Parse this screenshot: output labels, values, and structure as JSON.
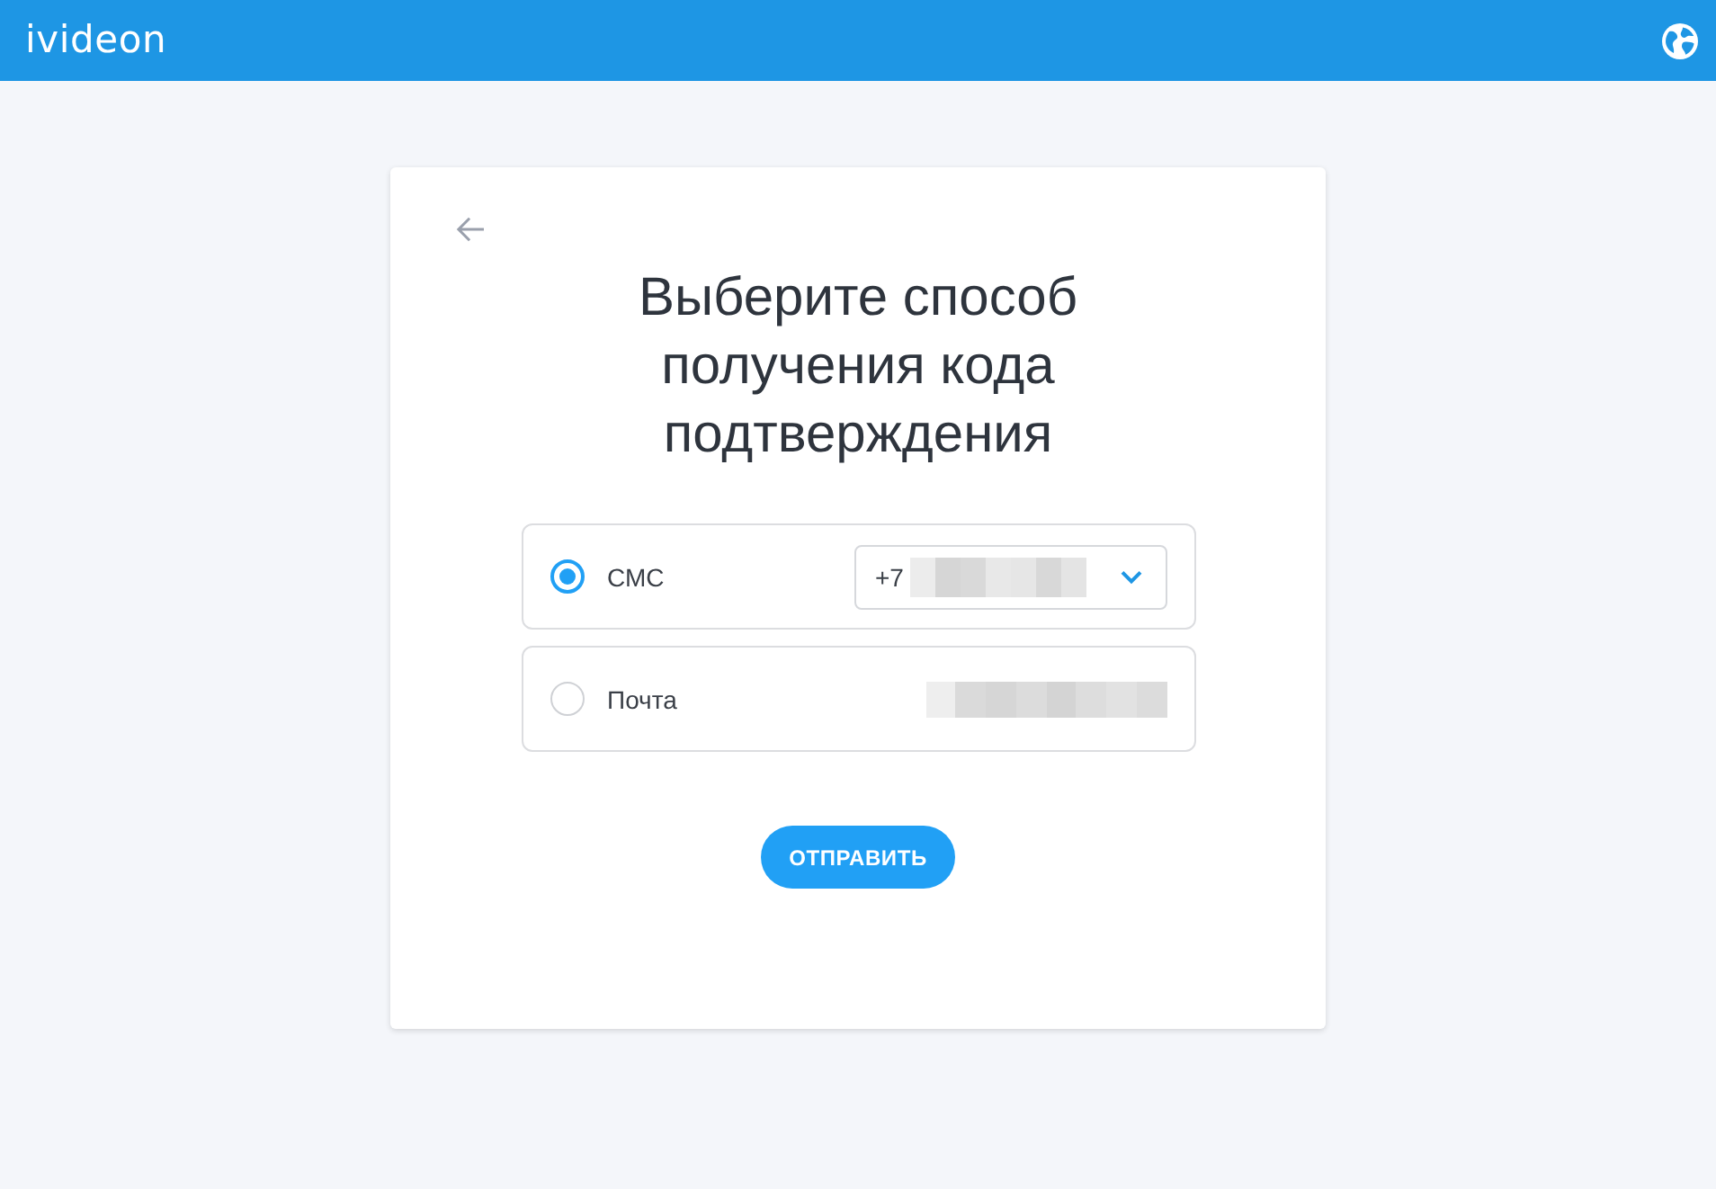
{
  "header": {
    "logo": "ivideon"
  },
  "card": {
    "title": "Выберите способ получения кода подтверждения",
    "options": [
      {
        "kind": "phone",
        "label": "СМС",
        "selected": true,
        "prefix": "+7"
      },
      {
        "kind": "email",
        "label": "Почта",
        "selected": false
      }
    ],
    "submit": "ОТПРАВИТЬ"
  }
}
